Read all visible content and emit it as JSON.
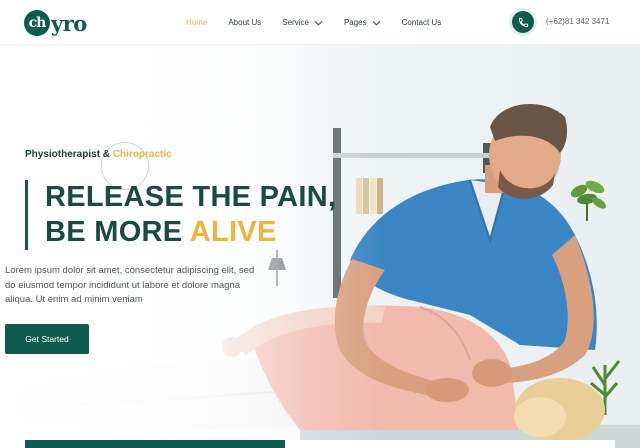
{
  "brand": {
    "logo_initial": "ch",
    "logo_rest": "yro"
  },
  "nav": {
    "items": [
      {
        "label": "Home",
        "active": true,
        "dropdown": false
      },
      {
        "label": "About Us",
        "active": false,
        "dropdown": false
      },
      {
        "label": "Service",
        "active": false,
        "dropdown": true
      },
      {
        "label": "Pages",
        "active": false,
        "dropdown": true
      },
      {
        "label": "Contact Us",
        "active": false,
        "dropdown": false
      }
    ]
  },
  "contact": {
    "phone": "(+62)81 342 3471",
    "icon": "phone-icon"
  },
  "hero": {
    "tagline_main": "Physiotherapist &",
    "tagline_accent": "Chiropractic",
    "headline_line1": "RELEASE THE PAIN,",
    "headline_line2_main": "BE MORE",
    "headline_line2_accent": "ALIVE",
    "description": "Lorem ipsum dolor sit amet, consectetur adipiscing elit, sed do eiusmod tempor incididunt ut labore et dolore magna aliqua. Ut enim ad minim veniam",
    "cta_label": "Get Started"
  },
  "colors": {
    "primary": "#0f5c4f",
    "accent": "#f0b33c",
    "text": "#1a4a42"
  }
}
